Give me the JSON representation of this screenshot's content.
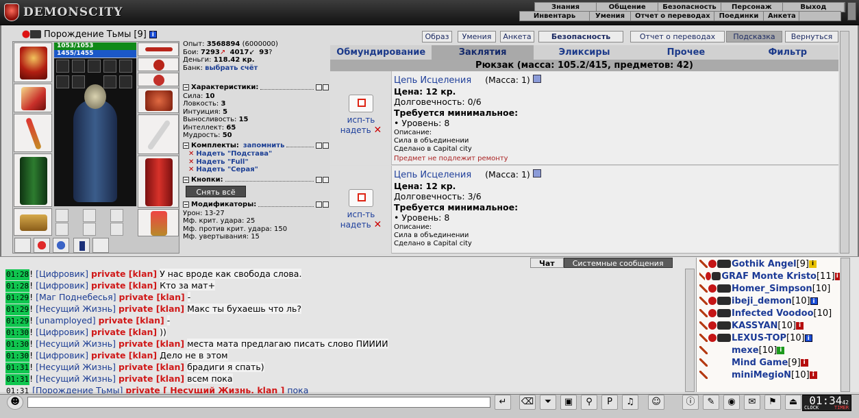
{
  "brand": {
    "logo_text": "DEMONSCITY"
  },
  "nav": {
    "row1": [
      "Знания",
      "Общение",
      "Безопасность",
      "Персонаж",
      "Выход"
    ],
    "row2": [
      "Инвентарь",
      "Умения",
      "Отчет о переводах",
      "Поединки",
      "Анкета"
    ]
  },
  "character": {
    "name": "Порождение Тьмы",
    "level": "[9]",
    "hp": "1053/1053",
    "mp": "1455/1455",
    "exp_label": "Опыт:",
    "exp": "3568894",
    "exp_next": "(6000000)",
    "fights_label": "Бои:",
    "wins": "7293",
    "losses": "4017",
    "draws": "93",
    "money_label": "Деньги:",
    "money": "118.42 кр.",
    "bank_label": "Банк:",
    "bank_link": "выбрать счёт"
  },
  "sections": {
    "characteristics": "Характеристики:",
    "sets": "Комплекты:",
    "sets_remember": "запомнить",
    "buttons": "Кнопки:",
    "modifiers": "Модификаторы:"
  },
  "stats": [
    {
      "label": "Сила:",
      "value": "10"
    },
    {
      "label": "Ловкость:",
      "value": "3"
    },
    {
      "label": "Интуиция:",
      "value": "5"
    },
    {
      "label": "Выносливость:",
      "value": "15"
    },
    {
      "label": "Интеллект:",
      "value": "65"
    },
    {
      "label": "Мудрость:",
      "value": "50"
    }
  ],
  "sets": [
    "Надеть \"Подстава\"",
    "Надеть \"Full\"",
    "Надеть \"Серая\""
  ],
  "unequip_all": "Снять всё",
  "modifiers": [
    "Урон: 13-27",
    "Мф. крит. удара: 25",
    "Мф. против крит. удара: 150",
    "Мф. увертывания: 15"
  ],
  "top_tabs": [
    "Образ",
    "Умения",
    "Анкета",
    "Безопасность",
    "Отчет о переводах",
    "Подсказка",
    "Вернуться"
  ],
  "inv_tabs": [
    "Обмундирование",
    "Заклятия",
    "Эликсиры",
    "Прочее",
    "Фильтр"
  ],
  "backpack": "Рюкзак (масса: 105.2/415, предметов: 42)",
  "items": [
    {
      "use": "исп-ть",
      "equip": "надеть",
      "name": "Цепь Исцеления",
      "mass": "(Масса: 1)",
      "price": "Цена: 12 кр.",
      "durability": "Долговечность: 0/6",
      "req": "Требуется минимальное:",
      "level": "• Уровень: 8",
      "desc_label": "Описание:",
      "desc1": "Сила в объединении",
      "desc2": "Сделано в Capital city",
      "warn": "Предмет не подлежит ремонту"
    },
    {
      "use": "исп-ть",
      "equip": "надеть",
      "name": "Цепь Исцеления",
      "mass": "(Масса: 1)",
      "price": "Цена: 12 кр.",
      "durability": "Долговечность: 3/6",
      "req": "Требуется минимальное:",
      "level": "• Уровень: 8",
      "desc_label": "Описание:",
      "desc1": "Сила в объединении",
      "desc2": "Сделано в Capital city",
      "warn": ""
    }
  ],
  "chat_tabs": [
    "Чат",
    "Системные сообщения"
  ],
  "chat": [
    {
      "t": "01:28",
      "n": "[Цифровик]",
      "p": "private [klan]",
      "m": "У нас вроде как свобода слова."
    },
    {
      "t": "01:28",
      "n": "[Цифровик]",
      "p": "private [klan]",
      "m": "Кто за мат+"
    },
    {
      "t": "01:29",
      "n": "[Маг Поднебесья]",
      "p": "private [klan]",
      "m": "-"
    },
    {
      "t": "01:29",
      "n": "[Несущий Жизнь]",
      "p": "private [klan]",
      "m": "Макс ты бухаешь что ль?"
    },
    {
      "t": "01:29",
      "n": "[unamployed]",
      "p": "private [klan]",
      "m": "-"
    },
    {
      "t": "01:30",
      "n": "[Цифровик]",
      "p": "private [klan]",
      "m": "))"
    },
    {
      "t": "01:30",
      "n": "[Несущий Жизнь]",
      "p": "private [klan]",
      "m": "места мата предлагаю писать слово ПИИИИ"
    },
    {
      "t": "01:30",
      "n": "[Цифровик]",
      "p": "private [klan]",
      "m": "Дело не в этом"
    },
    {
      "t": "01:31",
      "n": "[Несущий Жизнь]",
      "p": "private [klan]",
      "m": "брадиги я спать)"
    },
    {
      "t": "01:31",
      "n": "[Несущий Жизнь]",
      "p": "private [klan]",
      "m": "всем пока"
    },
    {
      "t": "01:31",
      "n": "[Порождение Тьмы]",
      "p": "private [ Несущий Жизнь, klan ]",
      "m": "пока",
      "own": true
    }
  ],
  "users": [
    {
      "name": "Gothik Angel",
      "lvl": "[9]",
      "badge": "y"
    },
    {
      "name": "GRAF Monte Kristo",
      "lvl": "[11]",
      "badge": "r"
    },
    {
      "name": "Homer_Simpson",
      "lvl": "[10]",
      "badge": ""
    },
    {
      "name": "ibeji_demon",
      "lvl": "[10]",
      "badge": "i"
    },
    {
      "name": "Infected Voodoo",
      "lvl": "[10]",
      "badge": ""
    },
    {
      "name": "KASSYAN",
      "lvl": "[10]",
      "badge": "r"
    },
    {
      "name": "LEXUS-TOP",
      "lvl": "[10]",
      "badge": "i"
    },
    {
      "name": "mexe",
      "lvl": "[10]",
      "badge": "g"
    },
    {
      "name": "Mind Game",
      "lvl": "[9]",
      "badge": "r"
    },
    {
      "name": "miniMegioN",
      "lvl": "[10]",
      "badge": "r"
    }
  ],
  "clock": {
    "time": "01:34",
    "sec": "42",
    "lbl_clock": "CLOCK",
    "lbl_timer": "TIMER"
  },
  "colors": {
    "link": "#1c3f94",
    "private": "#d01818",
    "timestamp": "#10c64f"
  }
}
